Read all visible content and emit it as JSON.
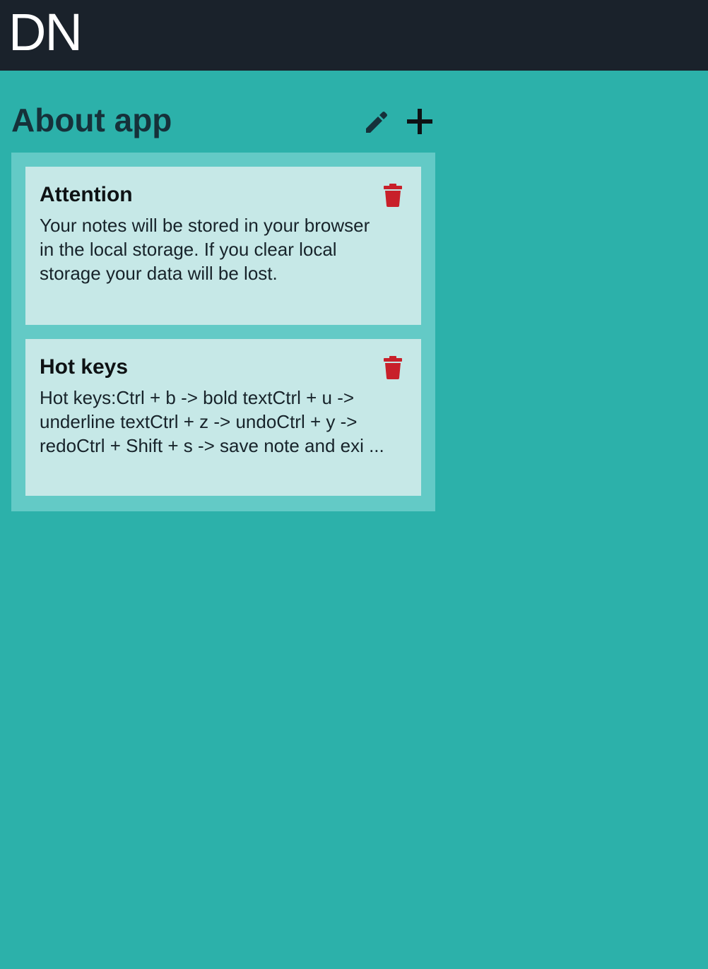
{
  "app": {
    "logo_text": "DN"
  },
  "section": {
    "title": "About app",
    "edit_icon": "pencil-icon",
    "add_icon": "plus-icon"
  },
  "notes": [
    {
      "title": "Attention",
      "body": "Your notes will be stored in your browser in the local storage. If you clear local storage your data will be lost.",
      "delete_icon": "trash-icon"
    },
    {
      "title": "Hot keys",
      "body": "Hot keys:Ctrl + b -> bold textCtrl + u -> underline textCtrl + z -> undoCtrl + y -> redoCtrl + Shift + s -> save note and exi ...",
      "delete_icon": "trash-icon"
    }
  ],
  "colors": {
    "topbar": "#1a222b",
    "background": "#2cb1aa",
    "panel": "#63cac6",
    "card": "#c6e8e7",
    "delete": "#c8202a",
    "title_text": "#16313a"
  }
}
